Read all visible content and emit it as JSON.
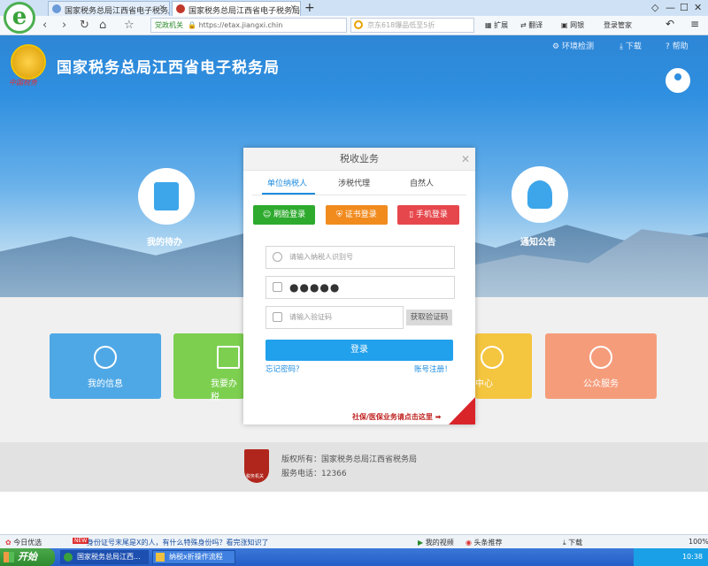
{
  "browser": {
    "tabs": [
      {
        "label": "国家税务总局江西省电子税务局_网"
      },
      {
        "label": "国家税务总局江西省电子税务局"
      }
    ],
    "new_tab": "+",
    "window_controls": {
      "restore": "◇",
      "minimize": "—",
      "maximize": "☐",
      "close": "✕"
    },
    "nav": {
      "back": "‹",
      "forward": "›",
      "refresh": "↻",
      "home": "⌂",
      "favorite": "☆"
    },
    "address": {
      "tag": "党政机关",
      "secure_icon": "lock-icon",
      "url": "https://etax.jiangxi.chin"
    },
    "search": {
      "text": "京东618爆品低至5折"
    },
    "toolbar": {
      "ext": "扩展",
      "translate": "翻译",
      "screenshot": "网银",
      "login": "登录管家",
      "undo": "↶",
      "menu": "≡"
    }
  },
  "header": {
    "title": "国家税务总局江西省电子税务局",
    "emblem_caption": "中国税务",
    "links": {
      "env_check": "环境检测",
      "download": "下载",
      "help": "帮助"
    },
    "login_label": "登录"
  },
  "banner": {
    "left_label": "我的待办",
    "right_label": "通知公告"
  },
  "tiles": [
    {
      "label": "我的信息",
      "color": "#4fa8e6"
    },
    {
      "label": "我要办税",
      "color": "#7ccf4f"
    },
    {
      "label": "中心",
      "color": "#f4c53f"
    },
    {
      "label": "公众服务",
      "color": "#f59c7b"
    }
  ],
  "footer": {
    "logo_text": "税务机关",
    "copyright": "版权所有：国家税务总局江西省税务局",
    "phone": "服务电话：12366"
  },
  "modal": {
    "title": "税收业务",
    "close": "✕",
    "tabs": [
      {
        "label": "单位纳税人",
        "active": true
      },
      {
        "label": "涉税代理",
        "active": false
      },
      {
        "label": "自然人",
        "active": false
      }
    ],
    "login_methods": [
      {
        "label": "刷脸登录",
        "color": "#2eab2e"
      },
      {
        "label": "证书登录",
        "color": "#f18b1e"
      },
      {
        "label": "手机登录",
        "color": "#e6474c"
      }
    ],
    "taxpayer_id": {
      "placeholder": "请输入纳税人识别号",
      "value": ""
    },
    "password": {
      "value": "●●●●●"
    },
    "captcha": {
      "placeholder": "请输入验证码",
      "value": ""
    },
    "get_code_label": "获取验证码",
    "submit_label": "登录",
    "forgot_label": "忘记密码？",
    "register_label": "账号注册！",
    "notice": "社保/医保业务请点击这里"
  },
  "status_bar": {
    "left": "今日优选",
    "news_badge": "NEW",
    "news": "身份证号末尾是X的人，有什么特殊身份吗？看完涨知识了",
    "video": "我的视频",
    "headline": "头条推荐",
    "download": "下载",
    "zoom": "100%"
  },
  "taskbar": {
    "start": "开始",
    "tasks": [
      "国家税务总局江西...",
      "纳税x折操作流程"
    ],
    "time": "10:38"
  }
}
